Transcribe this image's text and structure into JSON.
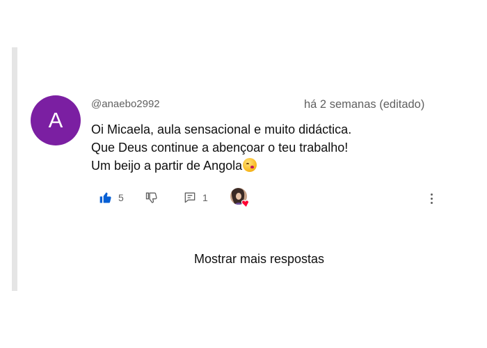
{
  "comment": {
    "avatar_letter": "A",
    "avatar_color": "#7b1fa2",
    "author": "@anaebo2992",
    "time": "há 2 semanas (editado)",
    "lines": [
      "Oi Micaela, aula sensacional e muito didáctica.",
      "Que Deus continue a abençoar o teu trabalho!",
      "Um beijo a partir de Angola"
    ],
    "emoji_icon": "kissing-face-icon"
  },
  "actions": {
    "like_count": "5",
    "reply_count": "1",
    "like_color": "#065fd4",
    "heart_color": "#ff0033",
    "icons": [
      "thumbs-up-icon",
      "thumbs-down-icon",
      "reply-icon",
      "creator-heart-icon",
      "more-vert-icon"
    ]
  },
  "replies": {
    "show_more_label": "Mostrar mais respostas"
  }
}
